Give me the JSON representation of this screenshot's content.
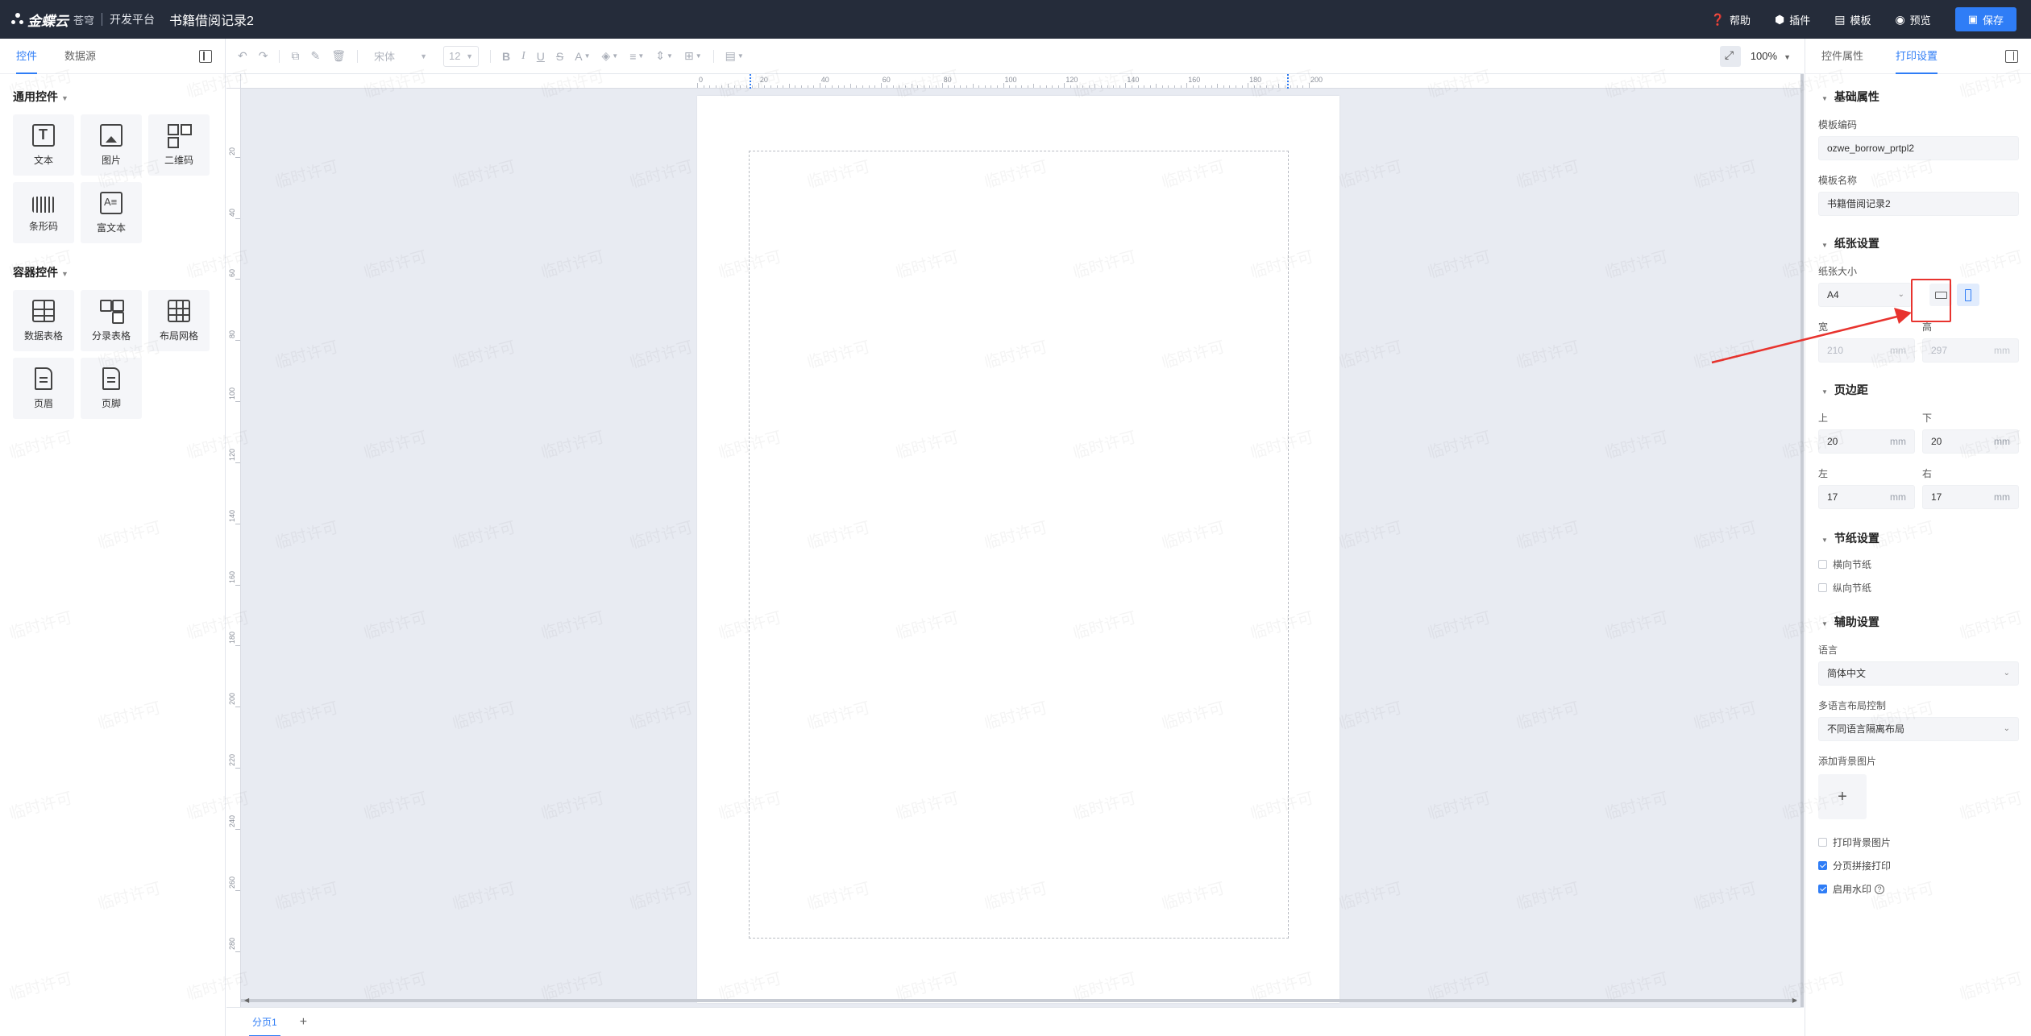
{
  "topbar": {
    "logo_text": "金蝶云",
    "logo_sub": "苍穹",
    "platform": "开发平台",
    "doc_title": "书籍借阅记录2",
    "actions": [
      {
        "label": "帮助",
        "icon": "help-icon"
      },
      {
        "label": "插件",
        "icon": "plugin-icon"
      },
      {
        "label": "模板",
        "icon": "template-icon"
      },
      {
        "label": "预览",
        "icon": "eye-icon"
      }
    ],
    "save_label": "保存"
  },
  "left_panel": {
    "tabs": [
      "控件",
      "数据源"
    ],
    "active_tab": "控件",
    "general_title": "通用控件",
    "general_controls": [
      {
        "label": "文本",
        "icon": "text-icon"
      },
      {
        "label": "图片",
        "icon": "image-icon"
      },
      {
        "label": "二维码",
        "icon": "qrcode-icon"
      },
      {
        "label": "条形码",
        "icon": "barcode-icon"
      },
      {
        "label": "富文本",
        "icon": "richtext-icon"
      }
    ],
    "container_title": "容器控件",
    "container_controls": [
      {
        "label": "数据表格",
        "icon": "data-table-icon"
      },
      {
        "label": "分录表格",
        "icon": "entry-table-icon"
      },
      {
        "label": "布局网格",
        "icon": "layout-grid-icon"
      },
      {
        "label": "页眉",
        "icon": "header-doc-icon"
      },
      {
        "label": "页脚",
        "icon": "footer-doc-icon"
      }
    ]
  },
  "toolbar": {
    "font_family": "宋体",
    "font_size": "12",
    "zoom": "100%"
  },
  "ruler": {
    "h_labels": [
      "0",
      "20",
      "40",
      "60",
      "80",
      "100",
      "120",
      "140",
      "160",
      "180",
      "200"
    ],
    "v_labels": [
      "20",
      "40",
      "60",
      "80",
      "100",
      "120",
      "140",
      "160",
      "180",
      "200",
      "220",
      "240",
      "260",
      "280"
    ]
  },
  "page_tabs": {
    "tabs": [
      "分页1"
    ],
    "add_label": "+"
  },
  "right_panel": {
    "tabs": [
      "控件属性",
      "打印设置"
    ],
    "active_tab": "打印设置",
    "basic": {
      "title": "基础属性",
      "code_label": "模板编码",
      "code_value": "ozwe_borrow_prtpl2",
      "name_label": "模板名称",
      "name_value": "书籍借阅记录2"
    },
    "paper": {
      "title": "纸张设置",
      "size_label": "纸张大小",
      "size_value": "A4",
      "width_label": "宽",
      "width_value": "210",
      "height_label": "高",
      "height_value": "297",
      "unit": "mm",
      "orientation": "portrait"
    },
    "margins": {
      "title": "页边距",
      "top_label": "上",
      "top_value": "20",
      "bottom_label": "下",
      "bottom_value": "20",
      "left_label": "左",
      "left_value": "17",
      "right_label": "右",
      "right_value": "17",
      "unit": "mm"
    },
    "section_paper": {
      "title": "节纸设置",
      "horizontal": "横向节纸",
      "vertical": "纵向节纸"
    },
    "assist": {
      "title": "辅助设置",
      "language_label": "语言",
      "language_value": "简体中文",
      "multilang_label": "多语言布局控制",
      "multilang_value": "不同语言隔离布局",
      "bg_label": "添加背景图片",
      "bg_add": "+",
      "print_bg": "打印背景图片",
      "page_join": "分页拼接打印",
      "watermark": "启用水印",
      "help_glyph": "?"
    }
  },
  "watermark_text": "临时许可",
  "colors": {
    "topbar": "#252c3a",
    "accent": "#2f7df6",
    "canvas_bg": "#e8ebf2",
    "annotation": "#e8332e"
  }
}
